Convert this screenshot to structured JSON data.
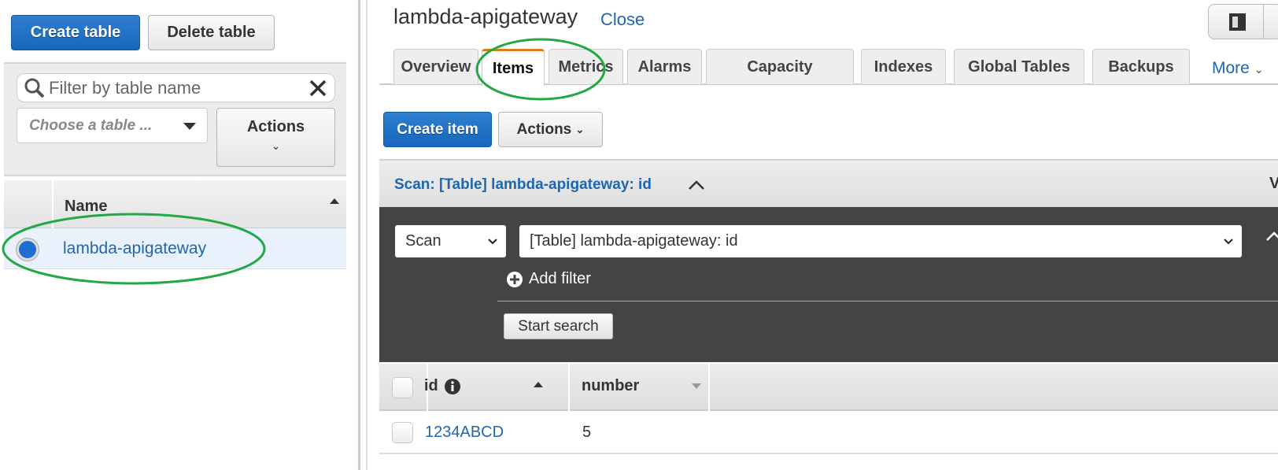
{
  "left": {
    "create_table": "Create table",
    "delete_table": "Delete table",
    "filter_placeholder": "Filter by table name",
    "choose_placeholder": "Choose a table ...",
    "actions": "Actions",
    "column_name": "Name",
    "tables": [
      {
        "name": "lambda-apigateway",
        "selected": true
      }
    ]
  },
  "main": {
    "title": "lambda-apigateway",
    "close": "Close",
    "tabs": [
      "Overview",
      "Items",
      "Metrics",
      "Alarms",
      "Capacity",
      "Indexes",
      "Global Tables",
      "Backups"
    ],
    "active_tab": "Items",
    "more": "More",
    "create_item": "Create item",
    "actions": "Actions",
    "scan_header": "Scan: [Table] lambda-apigateway: id",
    "scan_header_right": "V",
    "scan_mode": "Scan",
    "scan_target": "[Table] lambda-apigateway: id",
    "add_filter": "Add filter",
    "start_search": "Start search",
    "columns": [
      "id",
      "number"
    ],
    "rows": [
      {
        "id": "1234ABCD",
        "number": "5"
      }
    ]
  },
  "colors": {
    "primary": "#1766bd",
    "link": "#1f66b0",
    "active_tab": "#e07b13",
    "annotation": "#22a845",
    "scan_panel": "#444444"
  }
}
